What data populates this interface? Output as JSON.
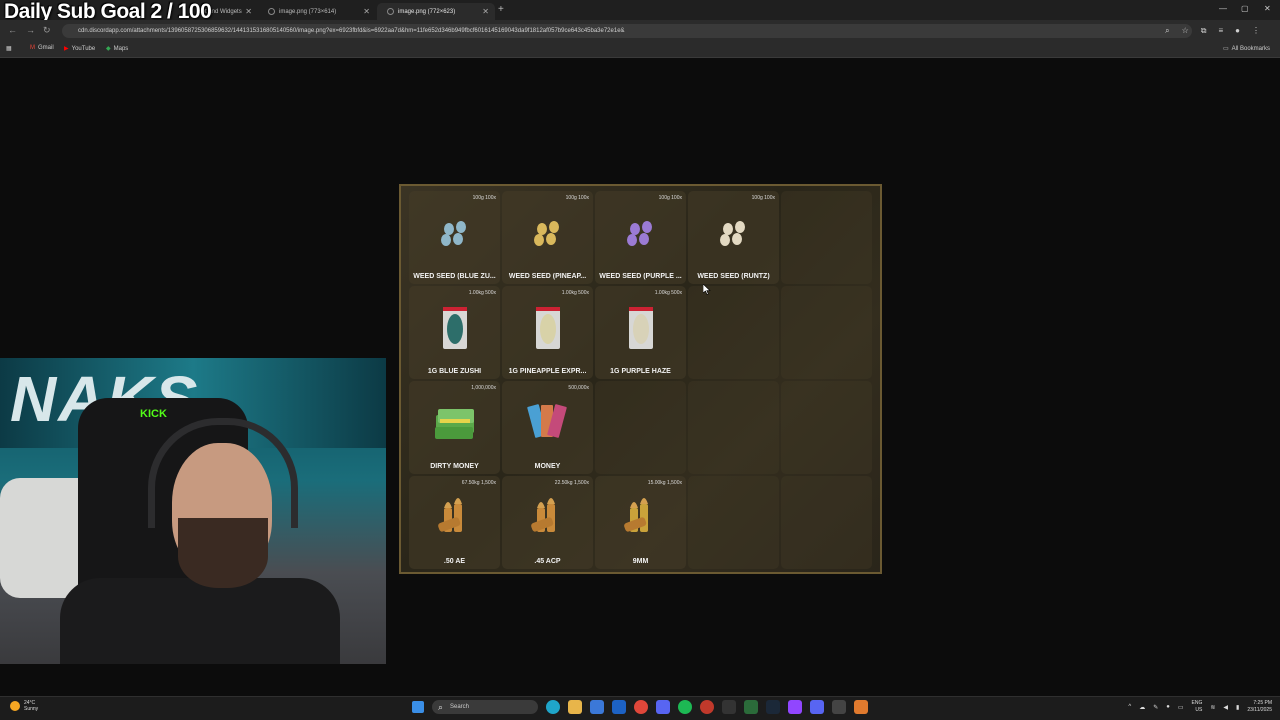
{
  "stream_overlay": {
    "goal_text": "Daily Sub Goal 2 / 100",
    "cam_brand": "NAKS",
    "chair_brand": "KICK"
  },
  "browser": {
    "tabs": [
      {
        "label": "tBot and Widgets",
        "active": false
      },
      {
        "label": "image.png (773×614)",
        "active": false
      },
      {
        "label": "image.png (772×623)",
        "active": true
      }
    ],
    "url": "cdn.discordapp.com/attachments/1396058725306859632/1441315316805140560/image.png?ex=6923fbfd&is=6922aa7d&hm=11fe652d346b949fbcf6016145169043da9f1812af057b9ce643c45ba3e72e1e&",
    "bookmarks": [
      {
        "label": "Gmail"
      },
      {
        "label": "YouTube"
      },
      {
        "label": "Maps"
      }
    ],
    "all_bookmarks": "All Bookmarks"
  },
  "inventory": {
    "slots": [
      {
        "label": "WEED SEED (BLUE ZU...",
        "weight": "100g 100x",
        "icon": "seed-icon",
        "color": "#8fb7c9"
      },
      {
        "label": "WEED SEED (PINEAP...",
        "weight": "100g 100x",
        "icon": "seed-icon",
        "color": "#d9b85c"
      },
      {
        "label": "WEED SEED (PURPLE ...",
        "weight": "100g 100x",
        "icon": "seed-icon",
        "color": "#9b7bd4"
      },
      {
        "label": "WEED SEED (RUNTZ)",
        "weight": "100g 100x",
        "icon": "seed-icon",
        "color": "#e3d9c2"
      },
      {
        "label": "",
        "weight": "",
        "icon": "",
        "color": ""
      },
      {
        "label": "1G BLUE ZUSHI",
        "weight": "1.00kg 500x",
        "icon": "bag-icon",
        "color": "#2d6e6a"
      },
      {
        "label": "1G PINEAPPLE EXPR...",
        "weight": "1.00kg 500x",
        "icon": "bag-icon",
        "color": "#d8d2a8"
      },
      {
        "label": "1G PURPLE HAZE",
        "weight": "1.00kg 500x",
        "icon": "bag-icon",
        "color": "#d8d2b8"
      },
      {
        "label": "",
        "weight": "",
        "icon": "",
        "color": ""
      },
      {
        "label": "",
        "weight": "",
        "icon": "",
        "color": ""
      },
      {
        "label": "DIRTY MONEY",
        "weight": "1,000,000x",
        "icon": "cash-icon",
        "color": "#5aa84a"
      },
      {
        "label": "MONEY",
        "weight": "500,000x",
        "icon": "banknotes-icon",
        "color": "#d47a4a"
      },
      {
        "label": "",
        "weight": "",
        "icon": "",
        "color": ""
      },
      {
        "label": "",
        "weight": "",
        "icon": "",
        "color": ""
      },
      {
        "label": "",
        "weight": "",
        "icon": "",
        "color": ""
      },
      {
        "label": ".50 AE",
        "weight": "67.50kg 1,500x",
        "icon": "bullets-icon",
        "color": "#c98a3a"
      },
      {
        "label": ".45 ACP",
        "weight": "22.50kg 1,500x",
        "icon": "bullets-icon",
        "color": "#c98a3a"
      },
      {
        "label": "9MM",
        "weight": "15.00kg 1,500x",
        "icon": "bullets-icon",
        "color": "#c9a23a"
      },
      {
        "label": "",
        "weight": "",
        "icon": "",
        "color": ""
      },
      {
        "label": "",
        "weight": "",
        "icon": "",
        "color": ""
      }
    ]
  },
  "taskbar": {
    "weather_temp": "24°C",
    "weather_desc": "Sunny",
    "search_placeholder": "Search",
    "lang_top": "ENG",
    "lang_bottom": "US",
    "time": "7:25 PM",
    "date": "23/11/2025"
  }
}
